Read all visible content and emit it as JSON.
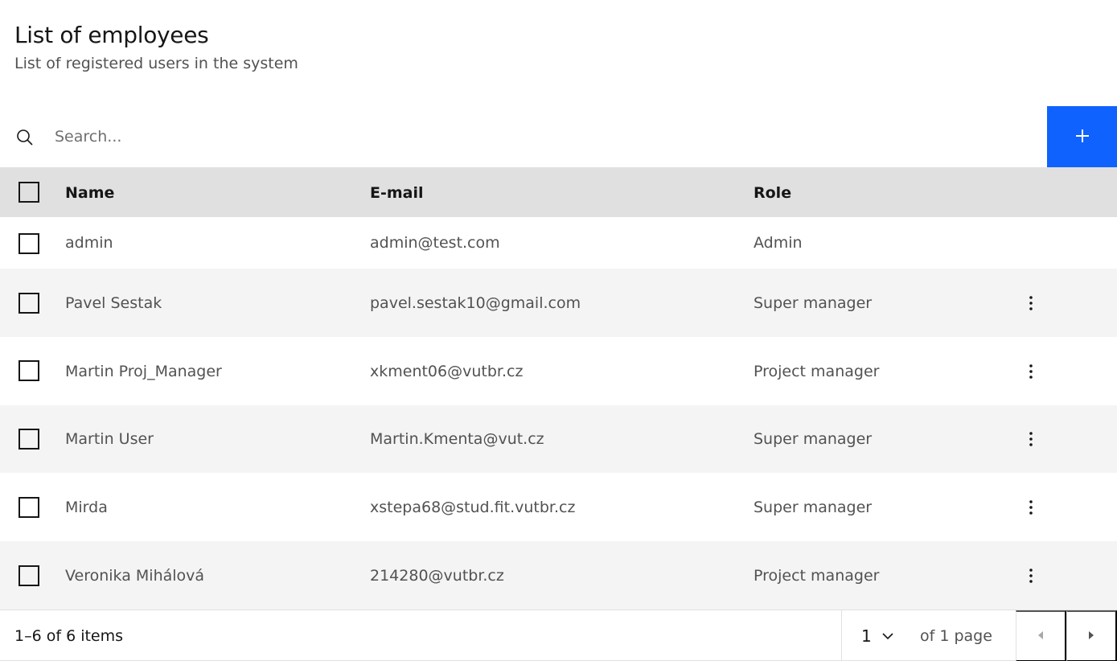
{
  "header": {
    "title": "List of employees",
    "subtitle": "List of registered users in the system"
  },
  "search": {
    "placeholder": "Search...",
    "icon": "search-icon"
  },
  "add_button": {
    "icon": "plus-icon",
    "color": "#0f62fe"
  },
  "table": {
    "columns": {
      "name": "Name",
      "email": "E-mail",
      "role": "Role"
    },
    "rows": [
      {
        "name": "admin",
        "email": "admin@test.com",
        "role": "Admin",
        "has_menu": false
      },
      {
        "name": "Pavel Sestak",
        "email": "pavel.sestak10@gmail.com",
        "role": "Super manager",
        "has_menu": true
      },
      {
        "name": "Martin Proj_Manager",
        "email": "xkment06@vutbr.cz",
        "role": "Project manager",
        "has_menu": true
      },
      {
        "name": "Martin User",
        "email": "Martin.Kmenta@vut.cz",
        "role": "Super manager",
        "has_menu": true
      },
      {
        "name": "Mirda",
        "email": "xstepa68@stud.fit.vutbr.cz",
        "role": "Super manager",
        "has_menu": true
      },
      {
        "name": "Veronika Mihálová",
        "email": "214280@vutbr.cz",
        "role": "Project manager",
        "has_menu": true
      }
    ]
  },
  "pagination": {
    "items_text": "1–6 of 6 items",
    "current_page": "1",
    "of_pages_text": "of 1 page"
  }
}
